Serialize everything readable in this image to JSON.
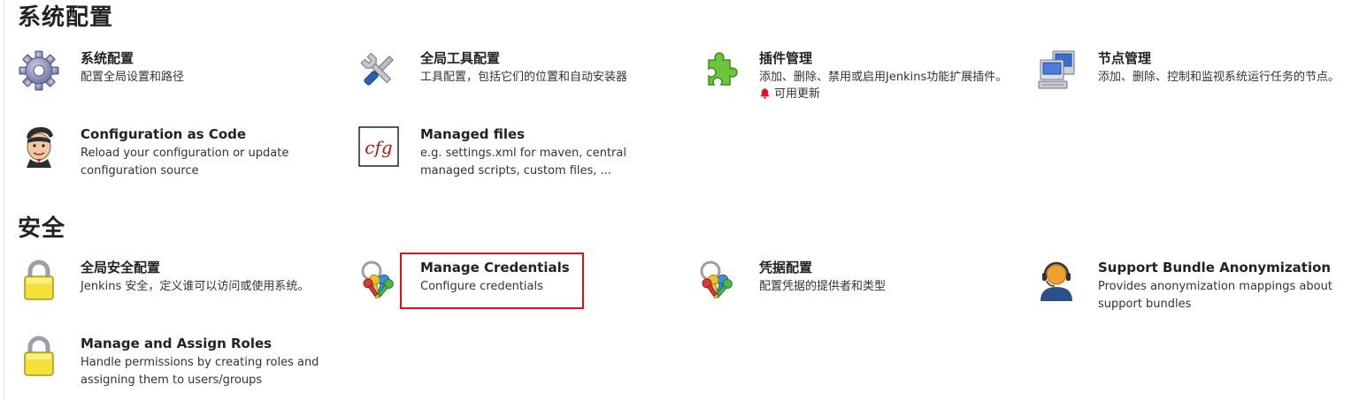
{
  "sections": {
    "system": {
      "title": "系统配置"
    },
    "security": {
      "title": "安全"
    }
  },
  "items": {
    "system_config": {
      "title": "系统配置",
      "desc": "配置全局设置和路径",
      "icon": "gear-icon"
    },
    "global_tools": {
      "title": "全局工具配置",
      "desc": "工具配置，包括它们的位置和自动安装器",
      "icon": "tools-icon"
    },
    "plugins": {
      "title": "插件管理",
      "desc": "添加、删除、禁用或启用Jenkins功能扩展插件。",
      "notice": "可用更新",
      "icon": "puzzle-piece-icon"
    },
    "nodes": {
      "title": "节点管理",
      "desc": "添加、删除、控制和监视系统运行任务的节点。",
      "icon": "computer-icon"
    },
    "casc": {
      "title": "Configuration as Code",
      "desc": "Reload your configuration or update configuration source",
      "icon": "jenkins-butler-icon"
    },
    "managed_files": {
      "title": "Managed files",
      "desc": "e.g. settings.xml for maven, central managed scripts, custom files, ...",
      "icon": "cfg-icon",
      "icon_text": "cfg"
    },
    "global_security": {
      "title": "全局安全配置",
      "desc": "Jenkins 安全，定义谁可以访问或使用系统。",
      "icon": "padlock-icon"
    },
    "manage_credentials": {
      "title": "Manage Credentials",
      "desc": "Configure credentials",
      "icon": "keys-icon"
    },
    "credential_config": {
      "title": "凭据配置",
      "desc": "配置凭据的提供者和类型",
      "icon": "keys-icon"
    },
    "support_bundle": {
      "title": "Support Bundle Anonymization",
      "desc": "Provides anonymization mappings about support bundles",
      "icon": "support-agent-icon"
    },
    "roles": {
      "title": "Manage and Assign Roles",
      "desc": "Handle permissions by creating roles and assigning them to users/groups",
      "icon": "padlock-icon"
    }
  },
  "colors": {
    "highlight": "#e0101a",
    "notice_bell": "#e8141c"
  }
}
